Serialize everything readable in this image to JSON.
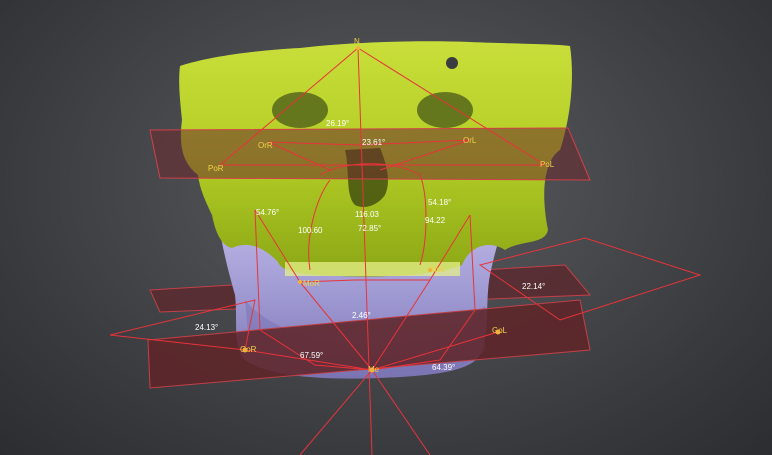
{
  "labels": {
    "orr": "OrR",
    "orl": "OrL",
    "por": "PoR",
    "pol": "PoL",
    "gor": "GoR",
    "gol": "GoL",
    "mor": "MoR",
    "mol": "MoL",
    "me": "Me",
    "n": "N"
  },
  "measurements": {
    "m1": "26.19°",
    "m2": "23.61°",
    "m3": "54.76°",
    "m4": "100.60",
    "m5": "116.03",
    "m6": "54.18°",
    "m7": "94.22",
    "m8": "72.85°",
    "m9": "22.14°",
    "m10": "24.13°",
    "m11": "67.59°",
    "m12": "64.39°",
    "m13": "2.46°"
  },
  "colors": {
    "bone_upper": "#b9d12c",
    "bone_lower": "#a49ed6",
    "plane": "#6b2a2e",
    "line": "#e8333a",
    "text": "#f2d24a"
  }
}
